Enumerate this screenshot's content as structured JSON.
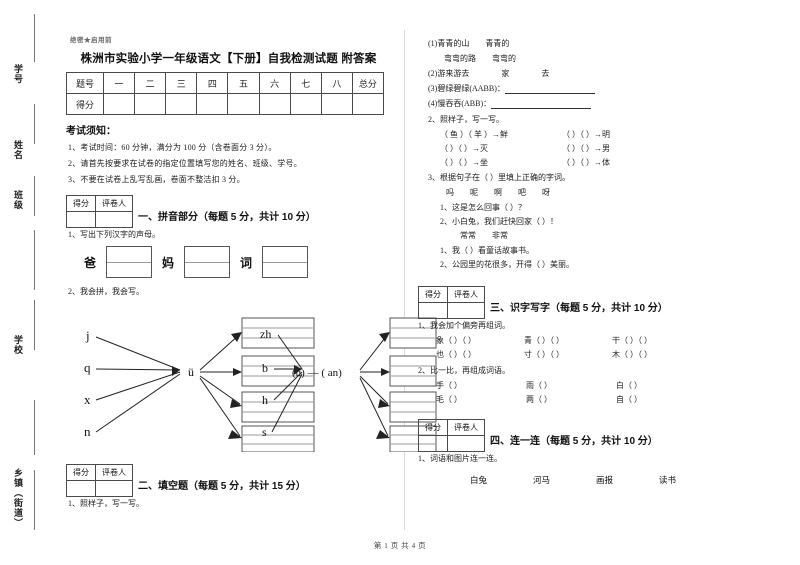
{
  "sidebar": {
    "vertical_labels": [
      "学号",
      "姓名",
      "班级",
      "学校",
      "乡镇（街道）"
    ]
  },
  "header": {
    "secret_mark": "绝密★启用前",
    "title": "株洲市实验小学一年级语文【下册】自我检测试题 附答案"
  },
  "score_table": {
    "row_labels": [
      "题号",
      "得分"
    ],
    "columns": [
      "一",
      "二",
      "三",
      "四",
      "五",
      "六",
      "七",
      "八",
      "总分"
    ]
  },
  "notice": {
    "heading": "考试须知：",
    "items": [
      "1、考试时间：60 分钟，满分为 100 分（含卷面分 3 分）。",
      "2、请首先按要求在试卷的指定位置填写您的姓名、班级、学号。",
      "3、不要在试卷上乱写乱画，卷面不整洁扣 3 分。"
    ]
  },
  "grade_box": {
    "score_label": "得分",
    "grader_label": "评卷人"
  },
  "sections": [
    {
      "id": "one",
      "title": "一、拼音部分（每题 5 分，共计 10 分）",
      "q1": "1、写出下列汉字的声母。",
      "chars": [
        "爸",
        "妈",
        "词"
      ],
      "q2": "2、我会拼，我会写。",
      "diagram_left": {
        "initials": [
          "j",
          "q",
          "x",
          "n"
        ],
        "final": "ü",
        "box_count": 4
      },
      "diagram_right": {
        "initials": [
          "zh",
          "b",
          "h",
          "s"
        ],
        "final": "(u) — ( an)",
        "box_count": 4
      }
    },
    {
      "id": "two",
      "title": "二、填空题（每题 5 分，共计 15 分）",
      "q1": "1、照样子，写一写。"
    },
    {
      "id": "three",
      "title": "三、识字写字（每题 5 分，共计 10 分）",
      "q1": "1、我会加个偏旁再组词。",
      "add_radical_rows": [
        [
          "象（  ）（     ）",
          "青（  ）（     ）",
          "干（  ）（     ）"
        ],
        [
          "也（  ）（     ）",
          "寸（  ）（     ）",
          "木（  ）（     ）"
        ]
      ],
      "q2": "2、比一比，再组成词语。",
      "compare_rows": [
        [
          "手（      ）",
          "雨（      ）",
          "白（      ）"
        ],
        [
          "毛（      ）",
          "两（      ）",
          "自（      ）"
        ]
      ]
    },
    {
      "id": "four",
      "title": "四、连一连（每题 5 分，共计 10 分）",
      "q1": "1、词语和图片连一连。",
      "words": [
        "白兔",
        "河马",
        "画报",
        "读书"
      ]
    }
  ],
  "right_top": {
    "fill_items": [
      "(1)青青的山　　青青的",
      "　　弯弯的路　　弯弯的",
      "(2)游来游去　　　　家　　　　去",
      "(3)碧绿碧绿(AABB)：",
      "(4)慢吞吞(ABB)："
    ],
    "q2_label": "2、照样子，写一写。",
    "compose_rows": [
      {
        "left": "（ 鱼 ）（ 羊 ）→鲜",
        "right": "（    ）（    ）→明"
      },
      {
        "left": "（    ）（    ）→灭",
        "right": "（    ）（    ）→男"
      },
      {
        "left": "（    ）（    ）→坐",
        "right": "（    ）（    ）→体"
      }
    ],
    "q3_label": "3、根据句子在（    ）里填上正确的字词。",
    "group1_words": "吗　　呢　　啊　　吧　　呀",
    "group1_items": [
      "1、这是怎么回事（       ）？",
      "2、小白兔，我们赶快回家（       ）！"
    ],
    "group2_words": "常常　　非常",
    "group2_items": [
      "1、我（           ）看童话故事书。",
      "2、公园里的花很多，开得（            ）美丽。"
    ]
  },
  "footer": {
    "text": "第 1 页 共 4 页"
  },
  "colors": {
    "ink": "#111111",
    "rule": "#4a4a4a",
    "light_rule": "#9a9a9a",
    "muted": "#6a6a6a"
  }
}
